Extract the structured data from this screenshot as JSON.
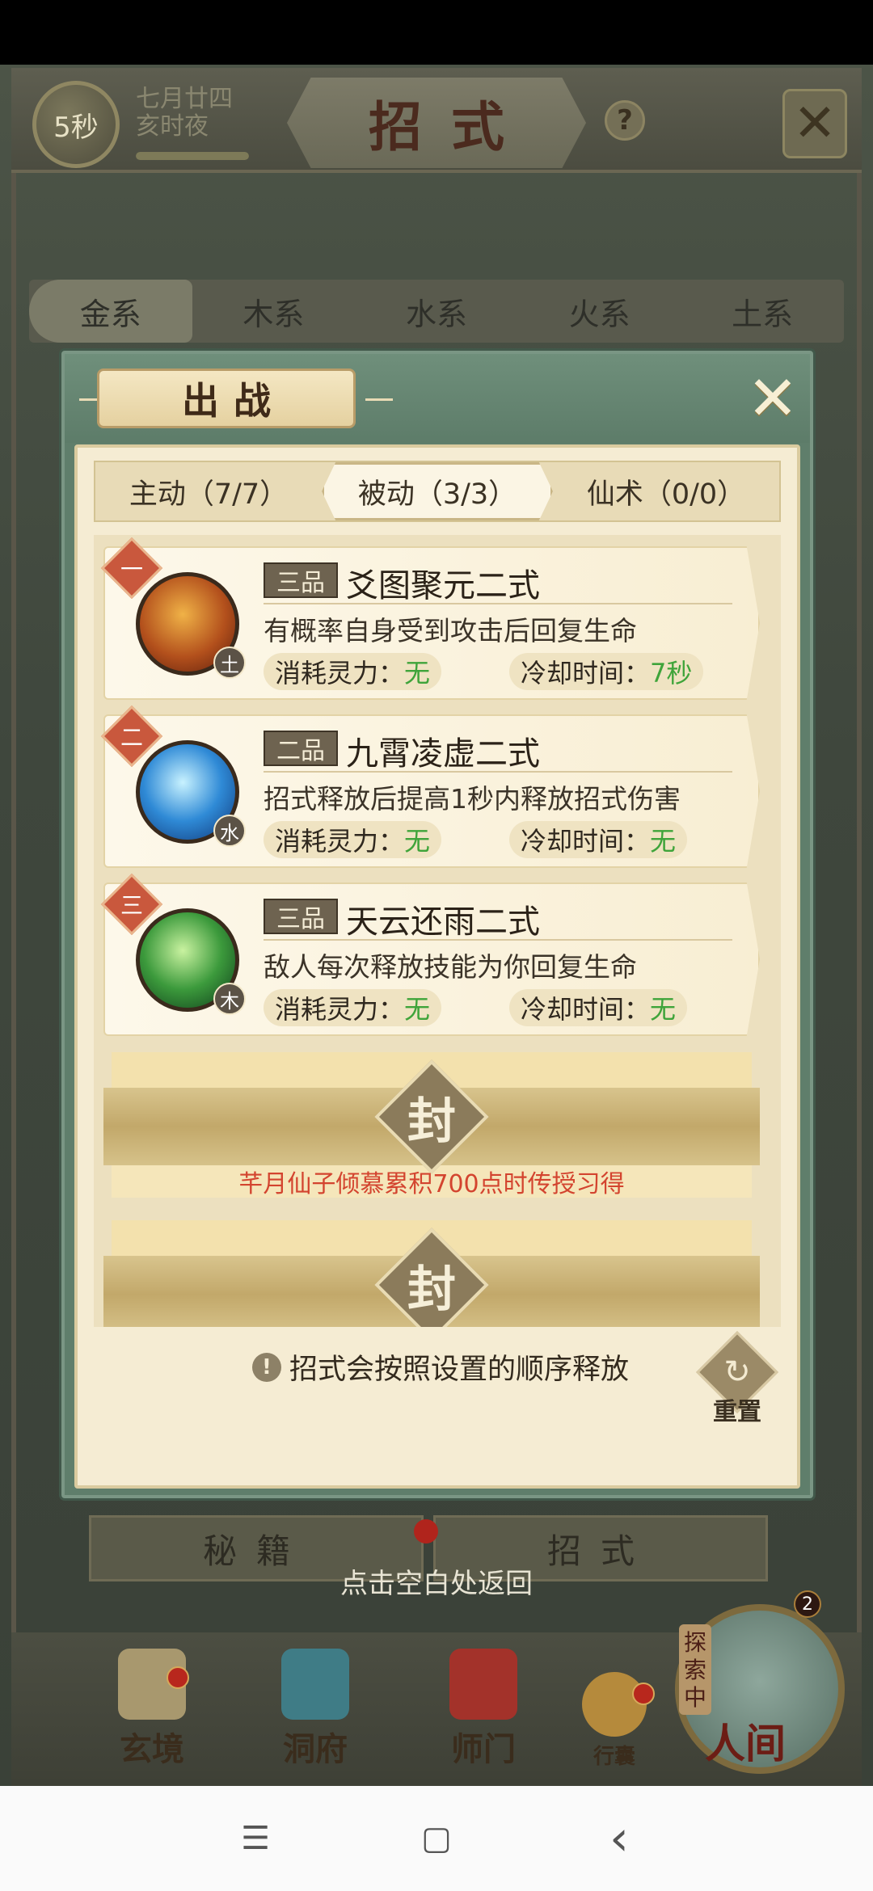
{
  "top": {
    "timer": "5秒",
    "date_line1": "七月廿四",
    "date_line2": "亥时夜",
    "title": "招式",
    "help": "?",
    "close": "✕"
  },
  "element_tabs": [
    "金系",
    "木系",
    "水系",
    "火系",
    "土系"
  ],
  "modal": {
    "title": "出战",
    "close": "✕",
    "sub_tabs": [
      "主动（7/7）",
      "被动（3/3）",
      "仙术（0/0）"
    ],
    "active_sub_tab": 1,
    "skills": [
      {
        "rank": "一",
        "element": "土",
        "grade": "三品",
        "name": "爻图聚元二式",
        "desc": "有概率自身受到攻击后回复生命",
        "cost_label": "消耗灵力：",
        "cost_value": "无",
        "cooldown_label": "冷却时间：",
        "cooldown_value": "7秒"
      },
      {
        "rank": "二",
        "element": "水",
        "grade": "二品",
        "name": "九霄凌虚二式",
        "desc": "招式释放后提高1秒内释放招式伤害",
        "cost_label": "消耗灵力：",
        "cost_value": "无",
        "cooldown_label": "冷却时间：",
        "cooldown_value": "无"
      },
      {
        "rank": "三",
        "element": "木",
        "grade": "三品",
        "name": "天云还雨二式",
        "desc": "敌人每次释放技能为你回复生命",
        "cost_label": "消耗灵力：",
        "cost_value": "无",
        "cooldown_label": "冷却时间：",
        "cooldown_value": "无"
      }
    ],
    "sealed": [
      {
        "char": "封",
        "requirement": "芊月仙子倾慕累积700点时传授习得"
      },
      {
        "char": "封",
        "requirement": ""
      }
    ],
    "order_hint": "招式会按照设置的顺序释放",
    "info_icon": "!",
    "reset_label": "重置",
    "reset_arrow": "↻"
  },
  "bottom_tabs": [
    "秘籍",
    "招式"
  ],
  "return_hint": "点击空白处返回",
  "nav": {
    "items": [
      "玄境",
      "洞府",
      "师门",
      "行囊"
    ],
    "explore_tag": "探索中",
    "world_label": "人间",
    "world_badge": "2"
  },
  "android_nav": {
    "menu": "☰",
    "home": "▢",
    "back": "‹"
  },
  "colors": {
    "accent_green": "#3fa43a",
    "requirement_red": "#d3442f",
    "rank_red": "#c9583d"
  }
}
